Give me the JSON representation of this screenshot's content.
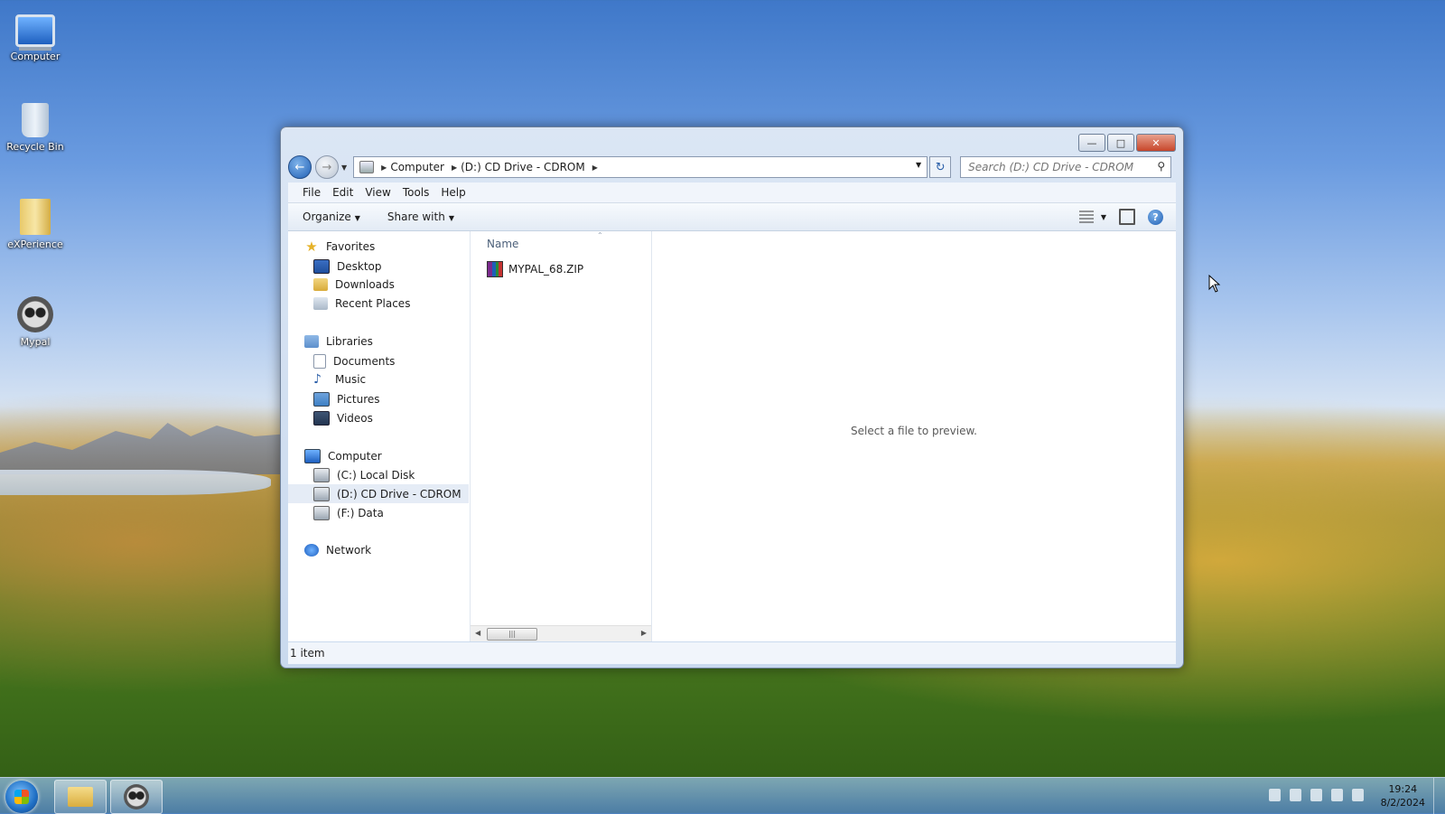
{
  "desktop": {
    "icons": [
      {
        "label": "Computer"
      },
      {
        "label": "Recycle Bin"
      },
      {
        "label": "eXPerience"
      },
      {
        "label": "Mypal"
      }
    ]
  },
  "window": {
    "address": {
      "crumbs": [
        "Computer",
        "(D:) CD Drive - CDROM"
      ]
    },
    "search_placeholder": "Search (D:) CD Drive - CDROM",
    "menu": [
      "File",
      "Edit",
      "View",
      "Tools",
      "Help"
    ],
    "toolbar": {
      "organize": "Organize",
      "share_with": "Share with"
    },
    "nav": {
      "favorites": "Favorites",
      "desktop": "Desktop",
      "downloads": "Downloads",
      "recent_places": "Recent Places",
      "libraries": "Libraries",
      "documents": "Documents",
      "music": "Music",
      "pictures": "Pictures",
      "videos": "Videos",
      "computer": "Computer",
      "local_disk": "(C:) Local Disk",
      "cd_drive": "(D:) CD Drive - CDROM",
      "data": "(F:) Data",
      "network": "Network"
    },
    "files": {
      "column_name": "Name",
      "items": [
        {
          "name": "MYPAL_68.ZIP"
        }
      ]
    },
    "preview_text": "Select a file to preview.",
    "status": "1 item"
  },
  "taskbar": {
    "time": "19:24",
    "date": "8/2/2024"
  }
}
